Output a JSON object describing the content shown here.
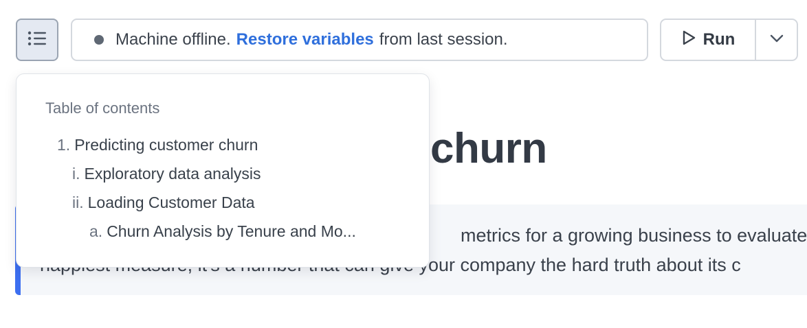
{
  "toolbar": {
    "toc_toggle_icon": "list-icon",
    "status": {
      "prefix": "Machine offline.",
      "link": "Restore variables",
      "suffix": "from last session."
    },
    "run_label": "Run",
    "run_icon": "play-icon",
    "menu_icon": "chevron-down-icon"
  },
  "notebook": {
    "heading_visible": "churn",
    "callout_line1": "metrics for a growing business to evaluate",
    "callout_line2": "happiest measure, it's a number that can give your company the hard truth about its c"
  },
  "toc": {
    "title": "Table of contents",
    "items": [
      {
        "num": "1.",
        "label": "Predicting customer churn"
      },
      {
        "num": "i.",
        "label": "Exploratory data analysis"
      },
      {
        "num": "ii.",
        "label": "Loading Customer Data"
      },
      {
        "num": "a.",
        "label": "Churn Analysis by Tenure and Mo..."
      }
    ]
  },
  "colors": {
    "accent": "#2f6fdc",
    "callout_border": "#3d6ff0",
    "status_dot": "#5f6874"
  }
}
